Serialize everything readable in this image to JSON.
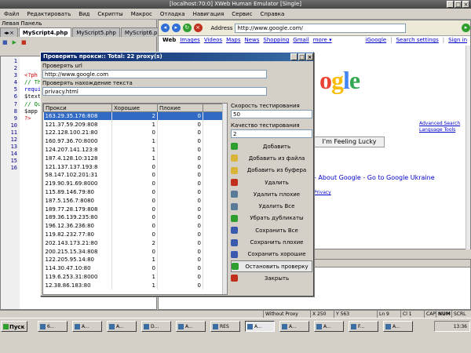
{
  "window": {
    "title": "[localhost:70:0] XWeb Human Emulator [Single]"
  },
  "menu": [
    "Файл",
    "Редактировать",
    "Вид",
    "Скрипты",
    "Макрос",
    "Отладка",
    "Навигация",
    "Сервис",
    "Справка"
  ],
  "left_panel": {
    "title": "Левая Панель",
    "tabs": [
      "MyScript4.php",
      "MyScript5.php",
      "MyScript6.ph"
    ],
    "line_numbers": [
      "1",
      "2",
      "3",
      "4",
      "5",
      "6",
      "7",
      "8",
      "9",
      "10",
      "11",
      "12",
      "13",
      "14",
      "15",
      "16"
    ],
    "code_lines": [
      "<?ph",
      "// The",
      "requi",
      "",
      "",
      "$text",
      "",
      "// Qu",
      "$app",
      "?>",
      "",
      "",
      "",
      "",
      "",
      ""
    ]
  },
  "browser": {
    "address_label": "Address",
    "url": "http://www.google.com/",
    "nav_links": [
      "Web",
      "Images",
      "Videos",
      "Maps",
      "News",
      "Shopping",
      "Gmail",
      "more ▾"
    ],
    "right_links": [
      "iGoogle",
      "|",
      "Search settings",
      "|",
      "Sign in"
    ],
    "logo_partial": "ogle",
    "feeling_lucky": "I'm Feeling Lucky",
    "advanced_search": "Advanced Search",
    "language_tools": "Language Tools",
    "about_line": "- About Google - Go to Google Ukraine",
    "privacy": "Privacy"
  },
  "dialog": {
    "title": "Проверить прокси:: Total: 22 proxy(s)",
    "proxy_url_label": "Проверять url",
    "proxy_url_value": "http://www.google.com",
    "find_text_label": "Проверять нахождение текста",
    "find_text_value": "privacy.html",
    "columns": [
      "Прокси",
      "Хорошие",
      "Плохие"
    ],
    "rows": [
      [
        "163.29.35.176:808",
        "2",
        "0"
      ],
      [
        "121.37.59.209:808",
        "1",
        "0"
      ],
      [
        "122.128.100.21:80",
        "0",
        "0"
      ],
      [
        "160.97.36.70:8000",
        "1",
        "0"
      ],
      [
        "124.207.141.123:8",
        "1",
        "0"
      ],
      [
        "187.4.128.10:3128",
        "1",
        "0"
      ],
      [
        "121.137.137.193:8",
        "0",
        "0"
      ],
      [
        "58.147.102.201:31",
        "0",
        "0"
      ],
      [
        "219.90.91.69:8000",
        "0",
        "0"
      ],
      [
        "115.89.146.79:80",
        "0",
        "0"
      ],
      [
        "187.5.156.7:8080",
        "0",
        "0"
      ],
      [
        "189.77.28.179:808",
        "0",
        "0"
      ],
      [
        "189.36.139.235:80",
        "0",
        "0"
      ],
      [
        "196.12.36.236:80",
        "0",
        "0"
      ],
      [
        "119.82.232.77:80",
        "0",
        "0"
      ],
      [
        "202.143.173.21:80",
        "2",
        "0"
      ],
      [
        "200.215.15.34:808",
        "0",
        "0"
      ],
      [
        "122.205.95.14:80",
        "1",
        "0"
      ],
      [
        "114.30.47.10:80",
        "0",
        "0"
      ],
      [
        "119.6.253.31:8000",
        "1",
        "0"
      ],
      [
        "12.38.86.183:80",
        "1",
        "0"
      ]
    ],
    "speed_label": "Скорость тестирования",
    "speed_value": "50",
    "quality_label": "Качество тестирования",
    "quality_value": "2",
    "actions": [
      {
        "label": "Добавить",
        "icon": "add-icon",
        "color": "#2e9e2e"
      },
      {
        "label": "Добавить из файла",
        "icon": "folder-icon",
        "color": "#d8b43a"
      },
      {
        "label": "Добавить из буфера",
        "icon": "clipboard-icon",
        "color": "#d8b43a"
      },
      {
        "label": "Удалить",
        "icon": "delete-icon",
        "color": "#c0301c"
      },
      {
        "label": "Удалить плохие",
        "icon": "delete-bad-icon",
        "color": "#5a7a9a"
      },
      {
        "label": "Удалить Все",
        "icon": "delete-all-icon",
        "color": "#5a7a9a"
      },
      {
        "label": "Убрать дубликаты",
        "icon": "dedupe-icon",
        "color": "#2e9e2e"
      },
      {
        "label": "Сохранить Все",
        "icon": "save-icon",
        "color": "#3a5ab0"
      },
      {
        "label": "Сохранить плохие",
        "icon": "save-bad-icon",
        "color": "#3a5ab0"
      },
      {
        "label": "Сохранить хорошие",
        "icon": "save-good-icon",
        "color": "#3a5ab0"
      },
      {
        "label": "Остановить проверку",
        "icon": "stop-icon",
        "color": "#2e9e2e"
      },
      {
        "label": "Закрыть",
        "icon": "close-icon",
        "color": "#c0301c"
      }
    ]
  },
  "status": {
    "proxy": "Without Proxy",
    "x": "X 250",
    "y": "Y 563",
    "ln": "Ln 9",
    "col": "Cl 1",
    "caps": "CAP",
    "num": "NUM",
    "scrl": "SCRL"
  },
  "taskbar": {
    "start": "Пуск",
    "buttons": [
      "6...",
      "A...",
      "A...",
      "D...",
      "A...",
      "RES",
      "A...",
      "A...",
      "A...",
      "F...",
      "A..."
    ],
    "clock": "13:36"
  }
}
